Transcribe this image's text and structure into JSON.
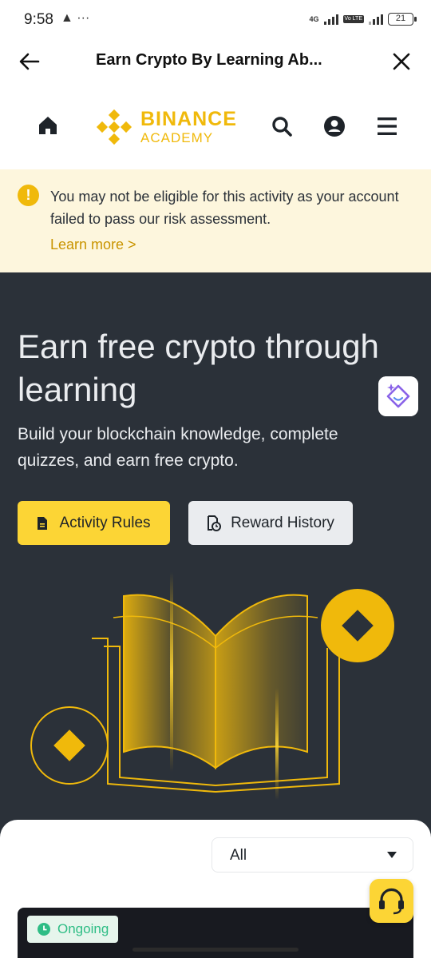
{
  "status_bar": {
    "time": "9:58",
    "extra_icons": "▲ ···",
    "network": "4G",
    "lte": "Vo LTE",
    "battery": "21"
  },
  "webview": {
    "title": "Earn Crypto By Learning Ab..."
  },
  "site": {
    "logo_primary": "BINANCE",
    "logo_secondary": "ACADEMY",
    "brand_color": "#f0b90b"
  },
  "banner": {
    "message": "You may not be eligible for this activity as your account failed to pass our risk assessment.",
    "link": "Learn more >"
  },
  "hero": {
    "title": "Earn free crypto through learning",
    "subtitle": "Build your blockchain knowledge, complete quizzes, and earn free crypto.",
    "primary_button": "Activity Rules",
    "secondary_button": "Reward History"
  },
  "filter": {
    "selected": "All"
  },
  "card": {
    "status": "Ongoing"
  }
}
